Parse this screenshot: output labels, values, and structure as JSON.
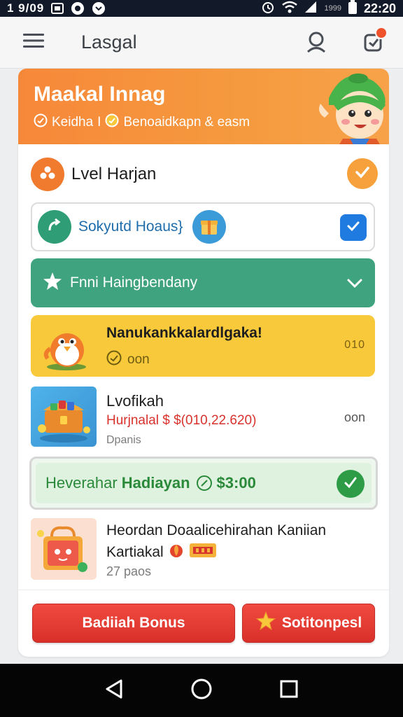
{
  "status_bar": {
    "time_left": "1 9/09",
    "clock": "22:20",
    "battery_label": "1999"
  },
  "app_bar": {
    "title": "Lasgal"
  },
  "hero": {
    "title": "Maakal Innag",
    "sub_left": "Keidha",
    "sub_sep": "I",
    "sub_right": "Benoaidkapn & easm"
  },
  "level": {
    "label": "Lvel Harjan"
  },
  "sokyutd": {
    "label": "Sokyutd Hoaus}"
  },
  "fnni": {
    "label": "Fnni Haingbendany"
  },
  "yellow_item": {
    "title": "Nanukankkalardlgaka!",
    "sub": "oon",
    "side": "010"
  },
  "lvo_item": {
    "title": "Lvofikah",
    "price": "Hurjnalal $ $(010,22.620)",
    "meta": "Dpanis",
    "side": "oon"
  },
  "green_row": {
    "text": "Heverahar",
    "bold": "Hadiayan",
    "amount": "$3:00"
  },
  "hen_item": {
    "title_line1": "Heordan Doaalicehirahan Kaniian",
    "title_line2": "Kartiakal",
    "meta": "27 paos"
  },
  "buttons": {
    "bonus": "Badiiah Bonus",
    "soti": "Sotitonpesl"
  },
  "colors": {
    "hero_orange": "#f6883a",
    "green_teal": "#3fa37f",
    "yellow": "#f8c93a",
    "red_button": "#e23a32",
    "check_blue": "#1f7be0"
  },
  "icons": {
    "menu": "hamburger-menu-icon",
    "profile": "person-icon",
    "notification": "notification-icon",
    "back": "back-triangle-icon",
    "home": "home-circle-icon",
    "recents": "recents-square-icon"
  }
}
